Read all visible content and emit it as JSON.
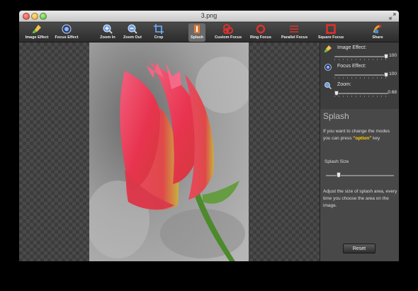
{
  "window": {
    "title": "3.png"
  },
  "toolbar": {
    "image_effect": "Image Effect",
    "focus_effect": "Focus Effect",
    "zoom_in": "Zoom In",
    "zoom_out": "Zoom Out",
    "crop": "Crop",
    "splash": "Splash",
    "custom_focus": "Custom Focus",
    "ring_focus": "Ring Focus",
    "parallel_focus": "Parallel Focus",
    "square_focus": "Square Focus",
    "share": "Share"
  },
  "panel": {
    "image_effect": {
      "label": "Image Effect:",
      "value": "100",
      "level": 1.0
    },
    "focus_effect": {
      "label": "Focus Effect:",
      "value": "100",
      "level": 1.0
    },
    "zoom": {
      "label": "Zoom:",
      "value": "0.68",
      "level": 0.0
    },
    "mode_title": "Splash",
    "mode_desc_before": "If you want to change the modes you can press ",
    "mode_desc_key": "\"option\"",
    "mode_desc_after": " key",
    "splash_size_label": "Splash Size",
    "splash_size_level": 0.17,
    "splash_size_desc": "Adjust the size of splash area, every time you choose the area on the image.",
    "reset_label": "Reset"
  },
  "colors": {
    "accent_highlight": "#ffd400",
    "tool_icon_red": "#e0302c",
    "panel_bg": "#484848"
  },
  "icons": {
    "image_effect": "brush-icon",
    "focus_effect": "lens-icon",
    "zoom_in": "zoom-in-icon",
    "zoom_out": "zoom-out-icon",
    "crop": "crop-icon",
    "splash": "splash-icon",
    "custom_focus": "custom-focus-icon",
    "ring_focus": "ring-focus-icon",
    "parallel_focus": "parallel-focus-icon",
    "square_focus": "square-focus-icon",
    "share": "share-icon"
  }
}
